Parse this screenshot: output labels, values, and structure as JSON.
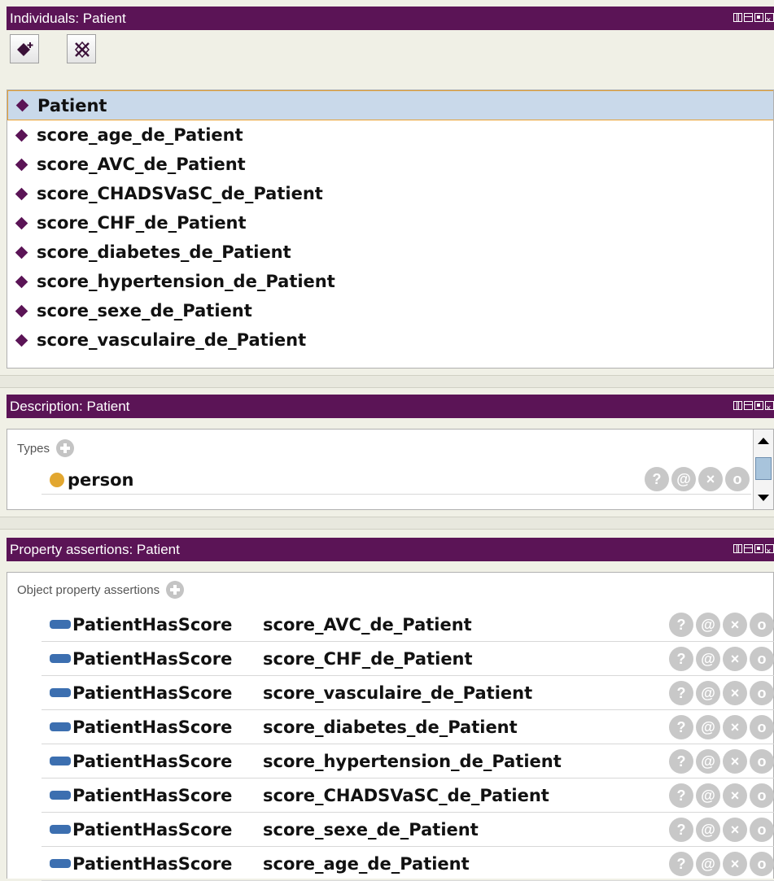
{
  "individuals_panel": {
    "title": "Individuals: Patient",
    "toolbar": {
      "add_icon": "add-individual-icon",
      "delete_icon": "delete-individual-icon"
    },
    "items": [
      "Patient",
      "score_age_de_Patient",
      "score_AVC_de_Patient",
      "score_CHADSVaSC_de_Patient",
      "score_CHF_de_Patient",
      "score_diabetes_de_Patient",
      "score_hypertension_de_Patient",
      "score_sexe_de_Patient",
      "score_vasculaire_de_Patient"
    ],
    "selected_index": 0
  },
  "description_panel": {
    "title": "Description: Patient",
    "types_label": "Types",
    "types": [
      {
        "name": "person"
      }
    ]
  },
  "property_panel": {
    "title": "Property assertions: Patient",
    "object_assertions_label": "Object property assertions",
    "assertions": [
      {
        "property": "PatientHasScore",
        "value": "score_AVC_de_Patient"
      },
      {
        "property": "PatientHasScore",
        "value": "score_CHF_de_Patient"
      },
      {
        "property": "PatientHasScore",
        "value": "score_vasculaire_de_Patient"
      },
      {
        "property": "PatientHasScore",
        "value": "score_diabetes_de_Patient"
      },
      {
        "property": "PatientHasScore",
        "value": "score_hypertension_de_Patient"
      },
      {
        "property": "PatientHasScore",
        "value": "score_CHADSVaSC_de_Patient"
      },
      {
        "property": "PatientHasScore",
        "value": "score_sexe_de_Patient"
      },
      {
        "property": "PatientHasScore",
        "value": "score_age_de_Patient"
      }
    ]
  },
  "row_actions": {
    "explain": "?",
    "annotate": "@",
    "delete": "×",
    "edit": "o"
  },
  "colors": {
    "title_bar": "#5b1456",
    "individual_icon": "#5b1456",
    "class_icon": "#e2a730",
    "object_property_icon": "#3c6fb0",
    "selection": "#c9d9ea"
  }
}
